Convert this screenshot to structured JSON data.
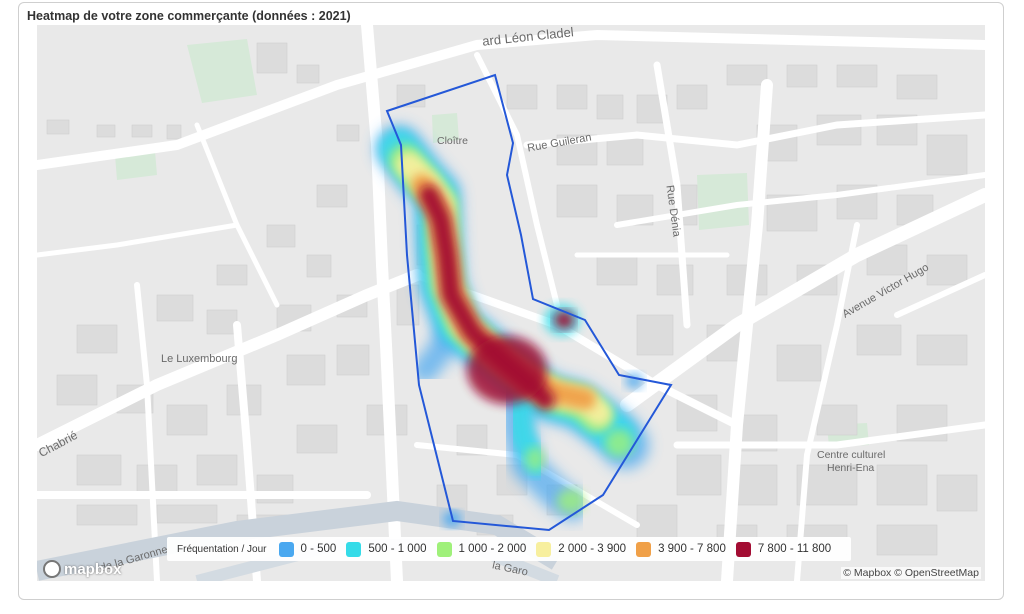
{
  "title": "Heatmap de votre zone commerçante (données : 2021)",
  "map": {
    "street_labels": {
      "top": "ard Léon Cladel",
      "cloitre": "Cloître",
      "guileran": "Rue Guileran",
      "denia": "Rue Dénia",
      "victor_hugo": "Avenue Victor Hugo",
      "luxembourg": "Le Luxembourg",
      "chabrie": "Chabrié",
      "garonne_left": "de la Garonne",
      "garonne_bottom": "la Garo",
      "centre_culturel_1": "Centre culturel",
      "centre_culturel_2": "Henri-Ena"
    },
    "attribution": "© Mapbox © OpenStreetMap",
    "logo": "mapbox"
  },
  "legend": {
    "title": "Fréquentation / Jour",
    "items": [
      {
        "label": "0 - 500",
        "color": "#4aa8f0"
      },
      {
        "label": "500 - 1 000",
        "color": "#35dbe8"
      },
      {
        "label": "1 000 - 2 000",
        "color": "#9ff07a"
      },
      {
        "label": "2 000 - 3 900",
        "color": "#f7ef9e"
      },
      {
        "label": "3 900 - 7 800",
        "color": "#f0a048"
      },
      {
        "label": "7 800 - 11 800",
        "color": "#a30d33"
      }
    ]
  },
  "colors": {
    "zone_outline": "#2458d8",
    "background": "#e9e9e9",
    "road": "#ffffff"
  }
}
